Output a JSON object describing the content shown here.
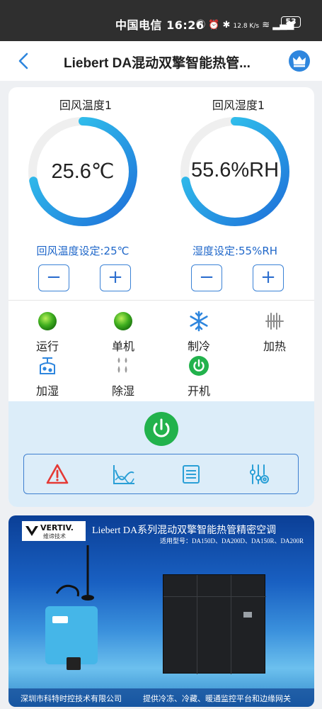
{
  "status_bar": {
    "carrier_time": "中国电信 16:26",
    "net_speed": "12.8 K/s",
    "battery": "53"
  },
  "header": {
    "title": "Liebert DA混动双擎智能热管..."
  },
  "gauges": [
    {
      "title": "回风温度1",
      "value": "25.6℃",
      "setpoint": "回风温度设定:25℃",
      "level": 0.72
    },
    {
      "title": "回风湿度1",
      "value": "55.6%RH",
      "setpoint": "湿度设定:55%RH",
      "level": 0.72
    }
  ],
  "steppers": {
    "minus": "−",
    "plus": "+"
  },
  "status_items": [
    {
      "label": "运行",
      "icon": "green-dot-icon"
    },
    {
      "label": "单机",
      "icon": "green-dot-icon"
    },
    {
      "label": "制冷",
      "icon": "snowflake-icon"
    },
    {
      "label": "加热",
      "icon": "heater-icon"
    },
    {
      "label": "加湿",
      "icon": "humidifier-icon"
    },
    {
      "label": "除湿",
      "icon": "dehumidify-icon"
    },
    {
      "label": "开机",
      "icon": "power-on-icon"
    }
  ],
  "toolbar": [
    "alarm-icon",
    "chart-icon",
    "list-icon",
    "settings-icon"
  ],
  "colors": {
    "accent": "#2e86de",
    "gauge_start": "#1e6fd9",
    "gauge_end": "#35d3f0",
    "power_green": "#22b24c",
    "setpoint_blue": "#1e66c9"
  },
  "banner": {
    "brand": "VERTIV.",
    "brand_sub": "维谛技术",
    "title": "Liebert DA系列混动双擎智能热管精密空调",
    "models": "适用型号：DA150D、DA200D、DA150R、DA200R",
    "footer_left": "深圳市科特时控技术有限公司",
    "footer_right": "提供冷冻、冷藏、暖通监控平台和边缘网关"
  }
}
